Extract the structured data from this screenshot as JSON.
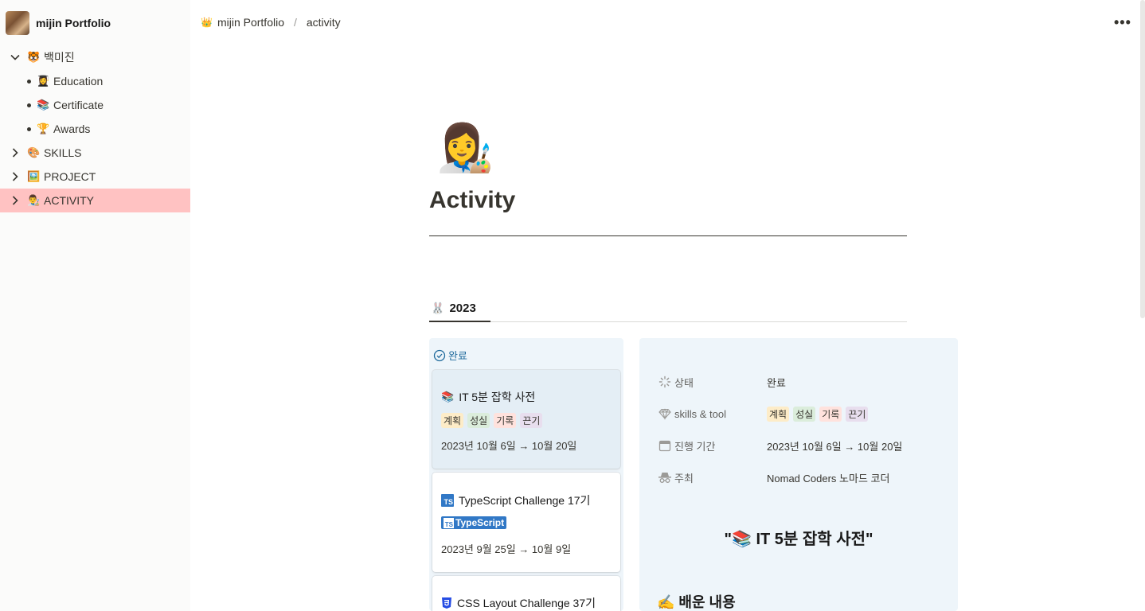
{
  "workspace": {
    "name": "mijin Portfolio"
  },
  "sidebar": {
    "items": [
      {
        "emoji": "🐯",
        "label": "백미진",
        "expanded": true
      },
      {
        "emoji": "👩‍🎓",
        "label": "Education"
      },
      {
        "emoji": "📚",
        "label": "Certificate"
      },
      {
        "emoji": "🏆",
        "label": "Awards"
      },
      {
        "emoji": "🎨",
        "label": "SKILLS",
        "expanded": false
      },
      {
        "emoji": "🖼️",
        "label": "PROJECT",
        "expanded": false
      },
      {
        "emoji": "👨‍🎨",
        "label": "ACTIVITY",
        "expanded": false,
        "active": true
      }
    ]
  },
  "breadcrumb": {
    "root_emoji": "👑",
    "root": "mijin Portfolio",
    "sep": "/",
    "current": "activity"
  },
  "topbar": {
    "more": "•••"
  },
  "page": {
    "icon": "👩‍🎨",
    "title": "Activity"
  },
  "tabs": [
    {
      "emoji": "🐰",
      "label": "2023"
    }
  ],
  "board": {
    "column": {
      "label": "완료"
    },
    "cards": [
      {
        "emoji": "📚",
        "title": "IT 5분 잡학 사전",
        "tags": [
          "계획",
          "성실",
          "기록",
          "끈기"
        ],
        "date": "2023년 10월 6일 → 10월 20일"
      },
      {
        "icon": "TS",
        "title": "TypeScript Challenge 17기",
        "badge": "TypeScript",
        "date": "2023년 9월 25일 → 10월 9일"
      },
      {
        "icon": "css",
        "title": "CSS Layout Challenge 37기"
      }
    ]
  },
  "detail": {
    "props": [
      {
        "icon": "loader-icon",
        "key": "상태",
        "value": "완료"
      },
      {
        "icon": "gem-icon",
        "key": "skills & tool",
        "tags": [
          "계획",
          "성실",
          "기록",
          "끈기"
        ]
      },
      {
        "icon": "calendar-icon",
        "key": "진행 기간",
        "value": "2023년 10월 6일 → 10월 20일"
      },
      {
        "icon": "spy-icon",
        "key": "주최",
        "value": "Nomad Coders 노마드 코더"
      }
    ],
    "quote": "\"📚 IT 5분 잡학 사전\"",
    "learn_heading": "✍️ 배운 내용"
  }
}
